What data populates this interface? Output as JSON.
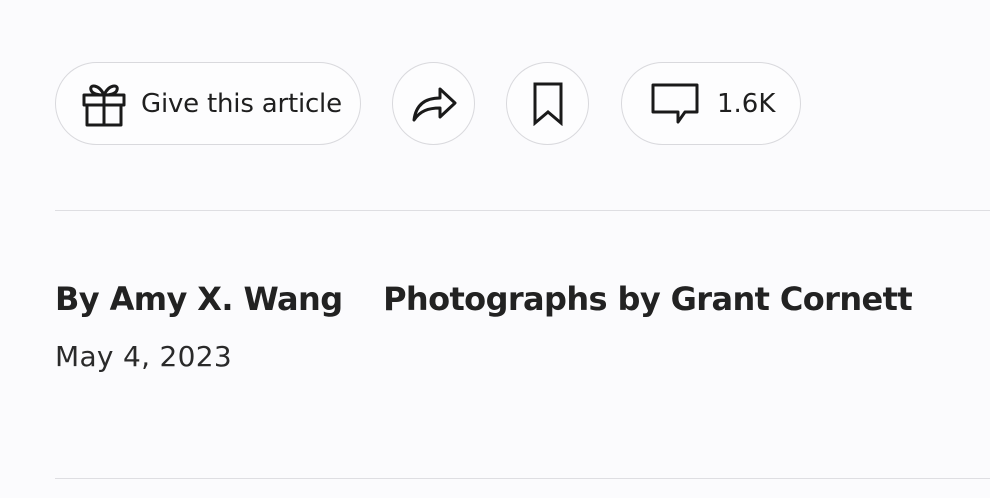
{
  "actions": {
    "gift": {
      "label": "Give this article",
      "icon": "gift-icon"
    },
    "share": {
      "icon": "share-icon"
    },
    "save": {
      "icon": "bookmark-icon"
    },
    "comments": {
      "count": "1.6K",
      "icon": "comment-icon"
    }
  },
  "article": {
    "author": "By Amy X. Wang",
    "photo_credit": "Photographs by Grant Cornett",
    "date": "May 4, 2023"
  },
  "colors": {
    "background": "#fbfbfd",
    "border": "#d9d9dd",
    "text": "#1a1a1a"
  }
}
